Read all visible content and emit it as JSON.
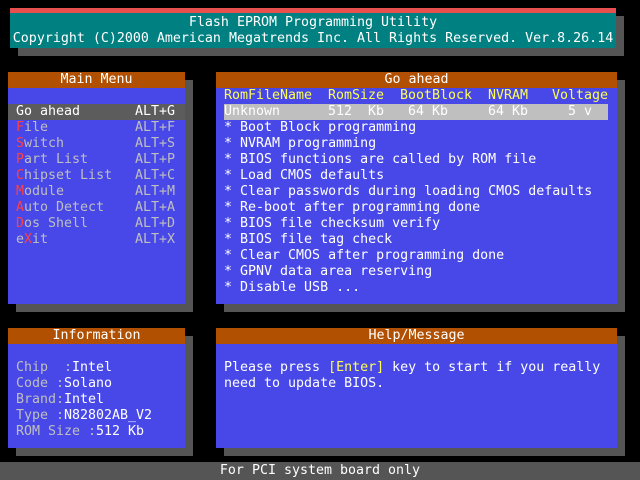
{
  "header": {
    "title": "Flash EPROM Programming Utility",
    "copyright": "Copyright (C)2000 American Megatrends Inc. All Rights Reserved. Ver.8.26.14"
  },
  "main_menu": {
    "title": "Main Menu",
    "items": [
      {
        "hot": "G",
        "rest": "o ahead",
        "key": "ALT+G",
        "selected": true
      },
      {
        "hot": "F",
        "rest": "ile",
        "key": "ALT+F"
      },
      {
        "hot": "S",
        "rest": "witch",
        "key": "ALT+S"
      },
      {
        "hot": "P",
        "rest": "art List",
        "key": "ALT+P"
      },
      {
        "hot": "C",
        "rest": "hipset List",
        "key": "ALT+C"
      },
      {
        "hot": "M",
        "rest": "odule",
        "key": "ALT+M"
      },
      {
        "hot": "A",
        "rest": "uto Detect",
        "key": "ALT+A"
      },
      {
        "hot": "D",
        "rest": "os Shell",
        "key": "ALT+D"
      },
      {
        "pre": "e",
        "hot": "X",
        "rest": "it",
        "key": "ALT+X"
      }
    ]
  },
  "go_ahead": {
    "title": "Go ahead",
    "columns": [
      "RomFileName",
      "RomSize",
      "BootBlock",
      "NVRAM",
      "Voltage"
    ],
    "row": [
      "Unknown",
      "512  Kb",
      "64 Kb",
      "64 Kb",
      "5 v"
    ],
    "options": [
      "* Boot Block programming",
      "* NVRAM programming",
      "* BIOS functions are called by ROM file",
      "* Load CMOS defaults",
      "* Clear passwords during loading CMOS defaults",
      "* Re-boot after programming done",
      "* BIOS file checksum verify",
      "* BIOS file tag check",
      "* Clear CMOS after programming done",
      "* GPNV data area reserving",
      "* Disable USB ..."
    ]
  },
  "information": {
    "title": "Information",
    "fields": [
      {
        "label": "Chip",
        "value": "Intel"
      },
      {
        "label": "Code",
        "value": "Solano"
      },
      {
        "label": "Brand",
        "value": "Intel"
      },
      {
        "label": "Type",
        "value": "N82802AB_V2"
      },
      {
        "label": "ROM Size",
        "value": "512 Kb"
      }
    ]
  },
  "help": {
    "title": "Help/Message",
    "line1_pre": "Please press ",
    "line1_key": "[Enter]",
    "line1_post": " key to start if you really",
    "line2": "need to update BIOS."
  },
  "footer": {
    "text": "For PCI system board only"
  },
  "colors": {
    "panel": "#4848e8",
    "title_bar": "#b05000",
    "header": "#008080",
    "accent_red": "#e85050",
    "highlight": "#ffff55",
    "hotkey": "#ff4040"
  }
}
